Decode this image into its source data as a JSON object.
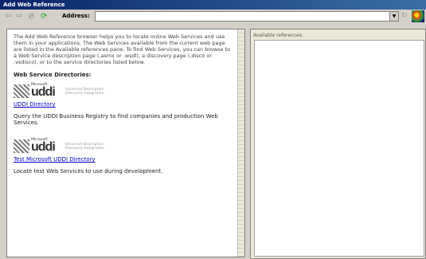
{
  "window": {
    "title": "Add Web Reference"
  },
  "toolbar": {
    "back_icon": "back-arrow-icon",
    "forward_icon": "forward-arrow-icon",
    "stop_icon": "stop-icon",
    "refresh_icon": "refresh-icon",
    "address_label": "Address:",
    "address_value": "",
    "go_icon": "go-icon"
  },
  "left": {
    "intro": "The Add Web Reference browser helps you to locate online Web Services and use them in your applications. The Web Services available from the current web page are listed in the Available references pane. To find Web Services, you can browse to a Web Service description page (.asmx or .wsdl), a discovery page (.disco or .vsdisco), or to the service directories listed below.",
    "heading": "Web Service Directories:",
    "directories": [
      {
        "logo_small": "Microsoft",
        "logo_big": "uddi",
        "logo_tag1": "Universal Description",
        "logo_tag2": "Discovery Integration",
        "link": "UDDI Directory",
        "description": "Query the UDDI Business Registry to find companies and production Web Services."
      },
      {
        "logo_small": "Microsoft",
        "logo_big": "uddi",
        "logo_tag1": "Universal Description",
        "logo_tag2": "Discovery Integration",
        "link": "Test Microsoft UDDI Directory",
        "description": "Locate test Web Services to use during development."
      }
    ]
  },
  "right": {
    "label": "Available references:"
  }
}
